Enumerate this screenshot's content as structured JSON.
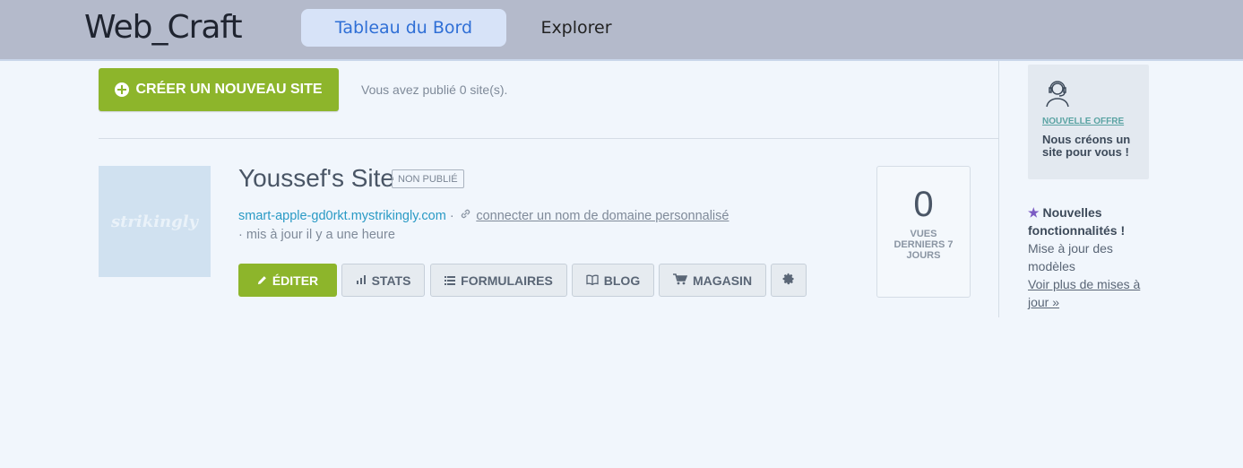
{
  "header": {
    "logo": "Web_Craft",
    "tabs": [
      "Tableau du Bord",
      "Explorer"
    ]
  },
  "toolbar": {
    "create_label": "CRÉER UN NOUVEAU SITE",
    "published_count": "Vous avez publié 0 site(s)."
  },
  "site": {
    "thumbnail_text": "strikingly",
    "name": "Youssef's Site",
    "status_badge": "NON PUBLIÉ",
    "url": "smart-apple-gd0rkt.mystrikingly.com",
    "separator": "·",
    "domain_link": "connecter un nom de domaine personnalisé",
    "updated": "· mis à jour il y a une heure",
    "actions": {
      "edit": "ÉDITER",
      "stats": "STATS",
      "forms": "FORMULAIRES",
      "blog": "BLOG",
      "store": "MAGASIN"
    },
    "views": {
      "count": "0",
      "label": "VUES DERNIERS 7 JOURS"
    }
  },
  "sidebar": {
    "offer_tag": "NOUVELLE OFFRE",
    "offer_text": "Nous créons un site pour vous !",
    "news_title": "Nouvelles fonctionnalités !",
    "news_body": "Mise à jour des modèles",
    "news_link": "Voir plus de mises à jour »"
  },
  "colors": {
    "accent_green": "#8db52b",
    "link_blue": "#2a9ac5",
    "star_purple": "#7c5cc4"
  }
}
